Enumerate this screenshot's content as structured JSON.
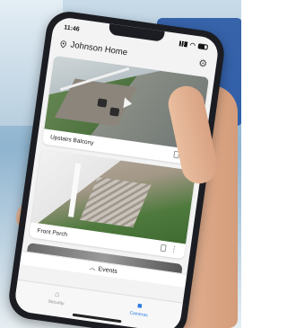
{
  "status_bar": {
    "time": "11:46"
  },
  "header": {
    "title": "Johnson Home"
  },
  "cameras": [
    {
      "label": "Upstairs Balcony"
    },
    {
      "label": "Front Porch"
    }
  ],
  "events": {
    "label": "Events"
  },
  "tabs": [
    {
      "label": "Security",
      "icon": "home-icon"
    },
    {
      "label": "Cameras",
      "icon": "video-camera-icon"
    }
  ],
  "colors": {
    "accent": "#2a7de1"
  }
}
